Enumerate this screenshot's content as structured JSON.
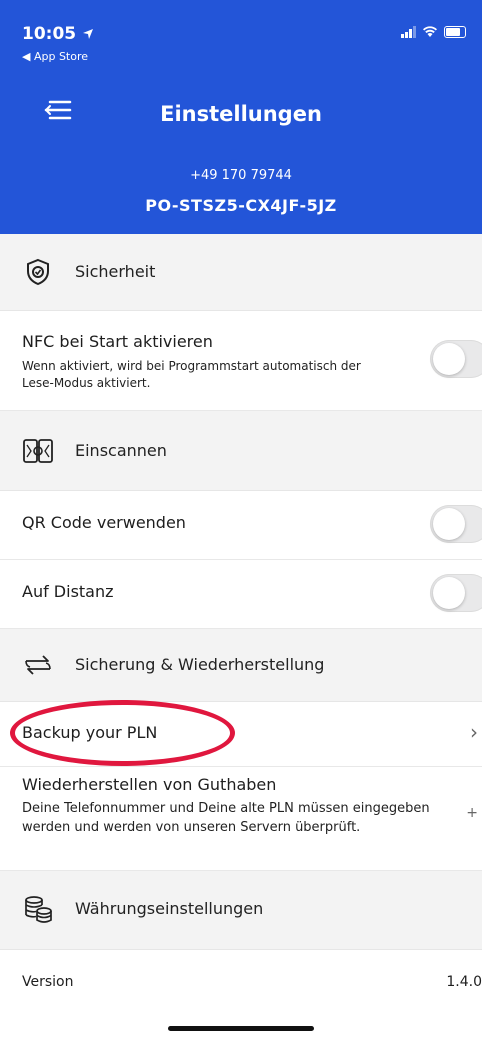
{
  "status_bar": {
    "time": "10:05",
    "back_label": "◀ App Store"
  },
  "header": {
    "title": "Einstellungen",
    "phone": "+49 170 79744",
    "code": "PO-STSZ5-CX4JF-5JZ"
  },
  "colors": {
    "header_bg": "#2355d8",
    "highlight_circle": "#e0173e"
  },
  "sections": {
    "security": {
      "label": "Sicherheit",
      "icon": "shield-icon",
      "nfc": {
        "title": "NFC bei Start aktivieren",
        "desc": "Wenn aktiviert, wird bei Programmstart automatisch der Lese-Modus aktiviert.",
        "enabled": false
      }
    },
    "scan": {
      "label": "Einscannen",
      "icon": "scan-icon",
      "qr": {
        "title": "QR Code verwenden",
        "enabled": false
      },
      "distance": {
        "title": "Auf Distanz",
        "enabled": false
      }
    },
    "backup": {
      "label": "Sicherung & Wiederherstellung",
      "icon": "sync-icon",
      "backup_pln": {
        "title": "Backup your PLN"
      },
      "restore": {
        "title": "Wiederherstellen von Guthaben",
        "desc": "Deine Telefonnummer und Deine alte PLN müssen eingegeben werden und werden von unseren Servern überprüft."
      }
    },
    "currency": {
      "label": "Währungseinstellungen",
      "icon": "coins-icon"
    }
  },
  "version": {
    "label": "Version",
    "value": "1.4.0"
  }
}
